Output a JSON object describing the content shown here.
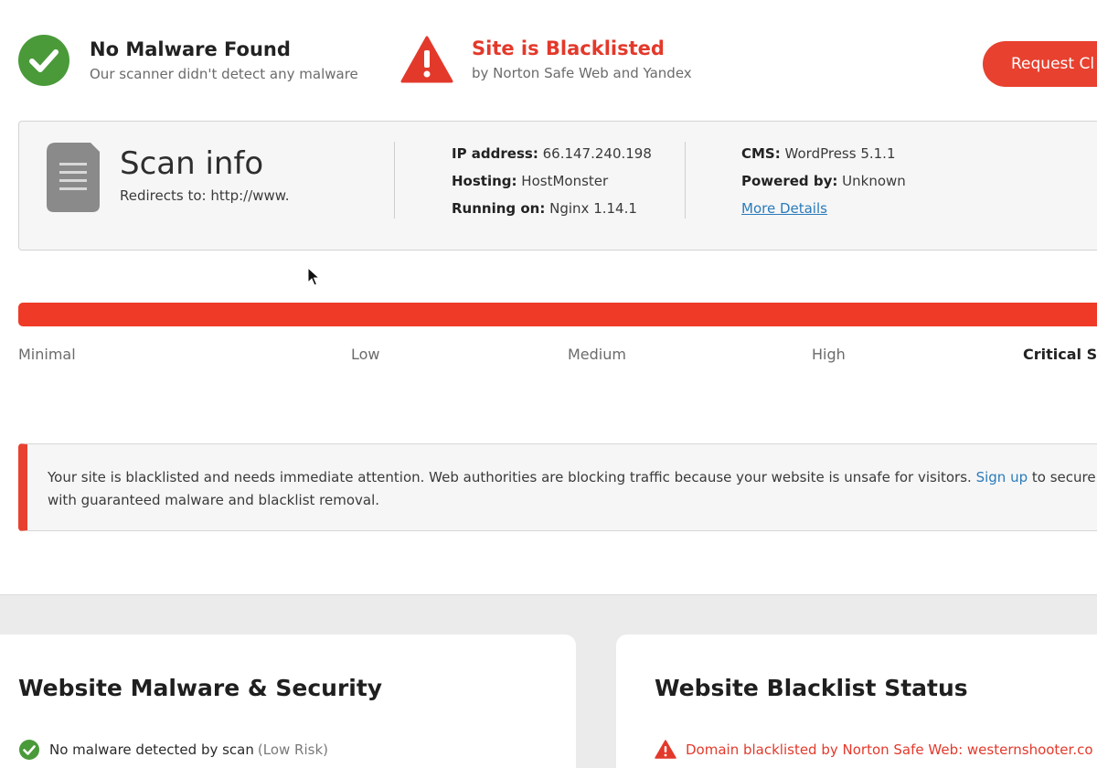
{
  "status": {
    "malware": {
      "title": "No Malware Found",
      "subtitle": "Our scanner didn't detect any malware"
    },
    "blacklist": {
      "title": "Site is Blacklisted",
      "subtitle": "by Norton Safe Web and Yandex"
    },
    "request_button": "Request Cl"
  },
  "scan_info": {
    "title": "Scan info",
    "redirect_label": "Redirects to: http://www.",
    "col1": [
      {
        "label": "IP address:",
        "value": "66.147.240.198"
      },
      {
        "label": "Hosting:",
        "value": "HostMonster"
      },
      {
        "label": "Running on:",
        "value": "Nginx 1.14.1"
      }
    ],
    "col2": [
      {
        "label": "CMS:",
        "value": "WordPress 5.1.1"
      },
      {
        "label": "Powered by:",
        "value": "Unknown"
      }
    ],
    "more_details": "More Details"
  },
  "risk": {
    "labels": [
      "Minimal",
      "Low",
      "Medium",
      "High",
      "Critical Se"
    ],
    "active_level": "Critical Se",
    "bar_color": "#ee3a26"
  },
  "alert": {
    "text_before": "Your site is blacklisted and needs immediate attention. Web authorities are blocking traffic because your website is unsafe for visitors.",
    "link": "Sign up",
    "text_after": "to secure y",
    "text_line2": "with guaranteed malware and blacklist removal."
  },
  "panels": {
    "malware": {
      "title": "Website Malware & Security",
      "item": "No malware detected by scan",
      "item_note": "(Low Risk)"
    },
    "blacklist": {
      "title": "Website Blacklist Status",
      "item": "Domain blacklisted by Norton Safe Web: westernshooter.co"
    }
  },
  "colors": {
    "accent_red": "#e8412f",
    "success_green": "#4a9a3a",
    "link_blue": "#2b7bb9"
  },
  "icons": [
    "check-circle-icon",
    "warning-triangle-icon",
    "document-icon",
    "cursor-icon"
  ]
}
